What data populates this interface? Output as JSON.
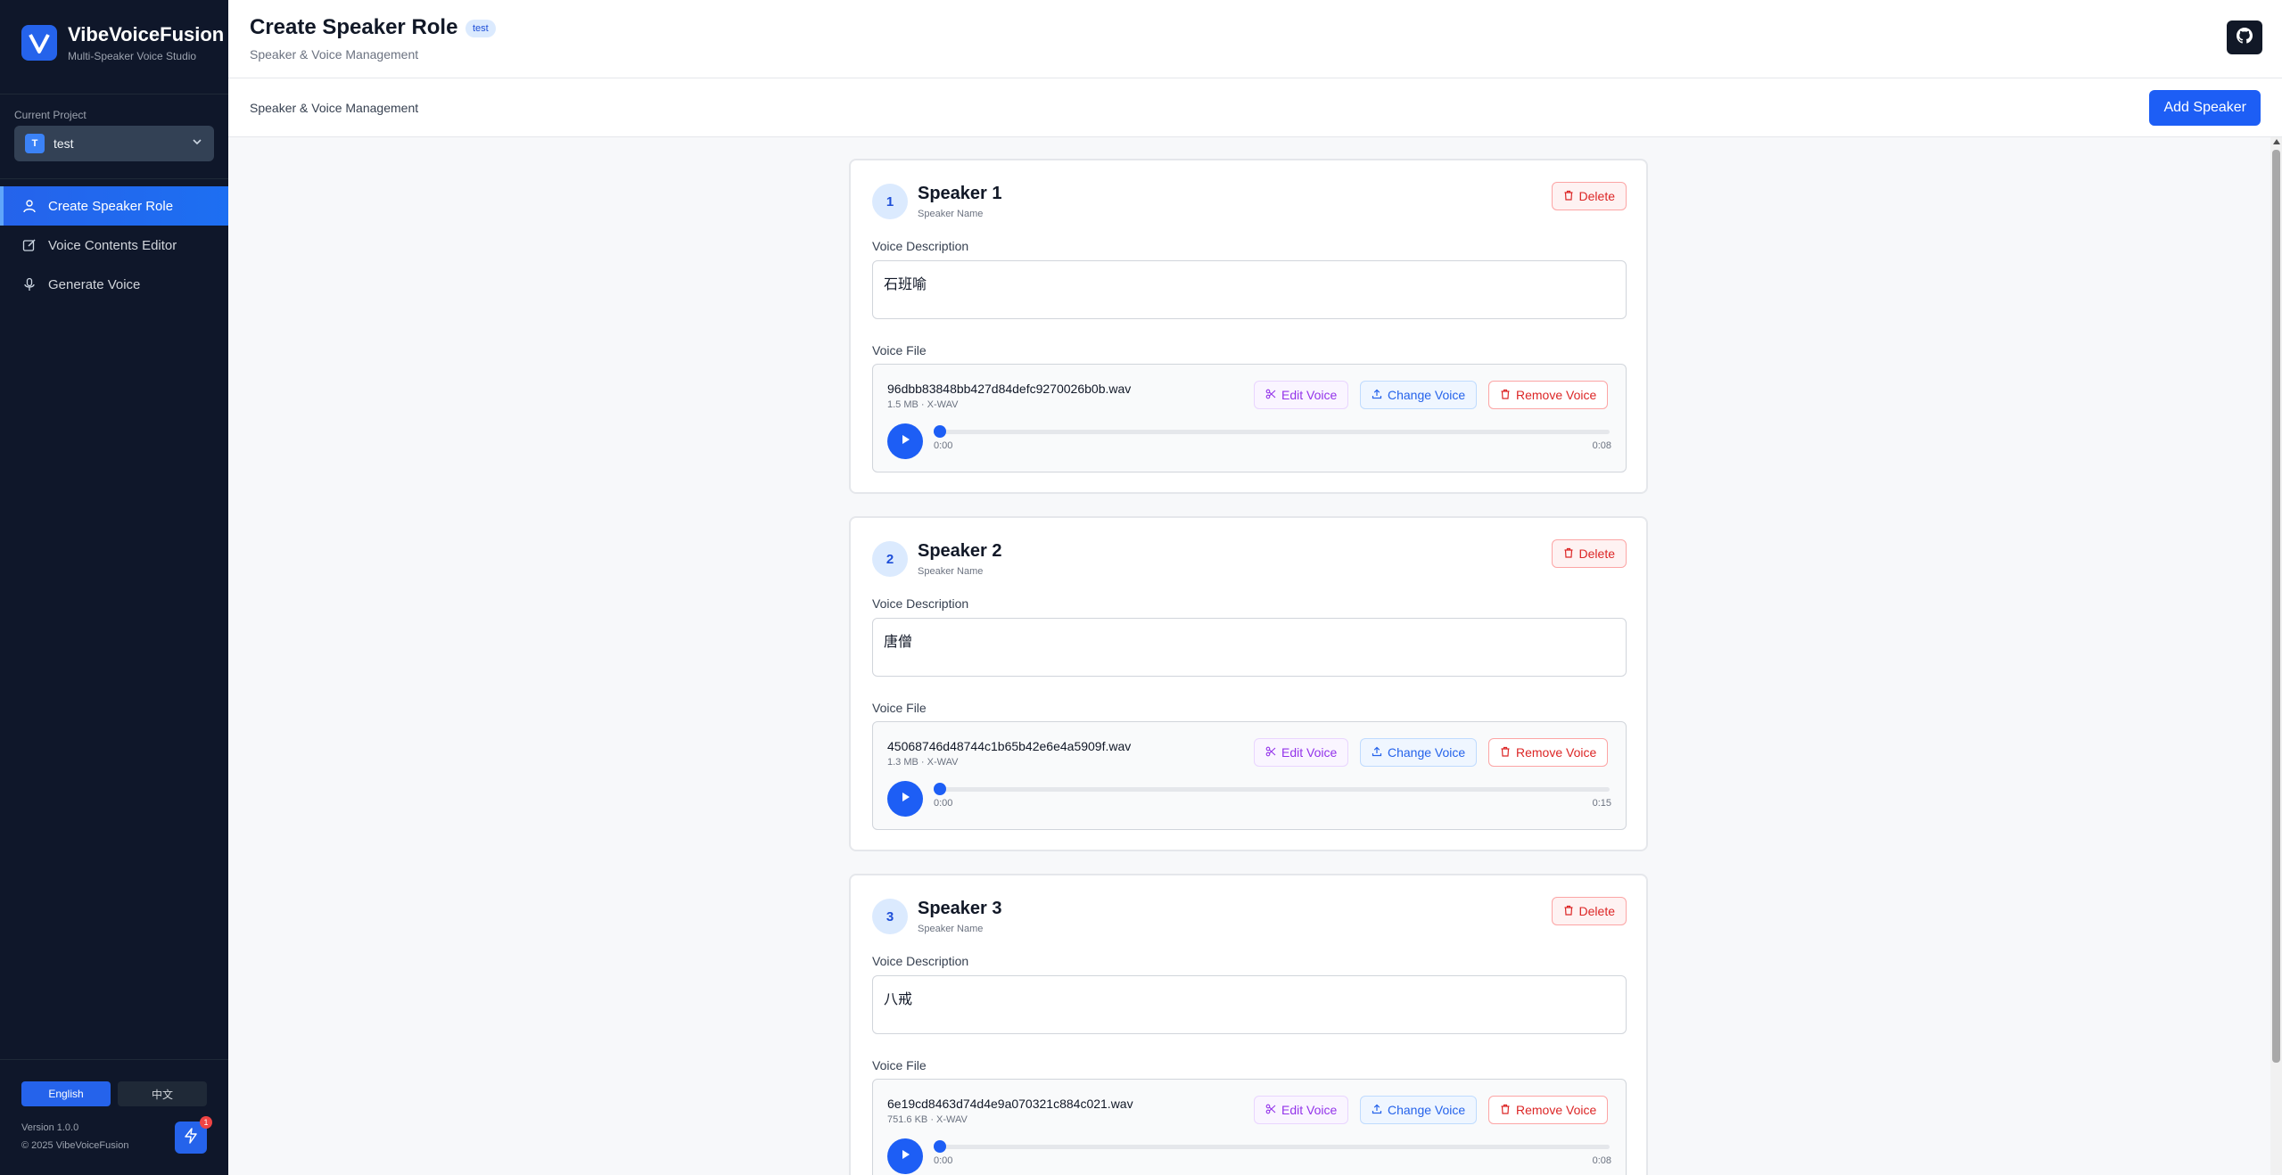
{
  "brand": {
    "title": "VibeVoiceFusion",
    "subtitle": "Multi-Speaker Voice Studio",
    "logo_letter": "V"
  },
  "project": {
    "label": "Current Project",
    "initial": "T",
    "name": "test"
  },
  "nav": [
    {
      "label": "Create Speaker Role",
      "icon": "user-icon",
      "active": true
    },
    {
      "label": "Voice Contents Editor",
      "icon": "edit-icon",
      "active": false
    },
    {
      "label": "Generate Voice",
      "icon": "microphone-icon",
      "active": false
    }
  ],
  "languages": {
    "english": "English",
    "chinese": "中文",
    "selected": "English"
  },
  "version": "Version 1.0.0",
  "copyright": "© 2025 VibeVoiceFusion",
  "notification_count": "1",
  "header": {
    "title": "Create Speaker Role",
    "badge": "test",
    "subtitle": "Speaker & Voice Management"
  },
  "toolbar": {
    "title": "Speaker & Voice Management",
    "add_button": "Add Speaker"
  },
  "labels": {
    "speaker_name": "Speaker Name",
    "delete": "Delete",
    "voice_description": "Voice Description",
    "voice_file": "Voice File",
    "edit_voice": "Edit Voice",
    "change_voice": "Change Voice",
    "remove_voice": "Remove Voice"
  },
  "speakers": [
    {
      "number": "1",
      "name": "Speaker 1",
      "description": "石班喻",
      "file_name": "96dbb83848bb427d84defc9270026b0b.wav",
      "file_meta": "1.5 MB · X-WAV",
      "time_current": "0:00",
      "time_total": "0:08"
    },
    {
      "number": "2",
      "name": "Speaker 2",
      "description": "唐僧",
      "file_name": "45068746d48744c1b65b42e6e4a5909f.wav",
      "file_meta": "1.3 MB · X-WAV",
      "time_current": "0:00",
      "time_total": "0:15"
    },
    {
      "number": "3",
      "name": "Speaker 3",
      "description": "八戒",
      "file_name": "6e19cd8463d74d4e9a070321c884c021.wav",
      "file_meta": "751.6 KB · X-WAV",
      "time_current": "0:00",
      "time_total": "0:08"
    }
  ],
  "colors": {
    "accent": "#1d5ef5",
    "sidebar": "#0f172a",
    "danger": "#dc2626",
    "purple": "#9333ea"
  }
}
